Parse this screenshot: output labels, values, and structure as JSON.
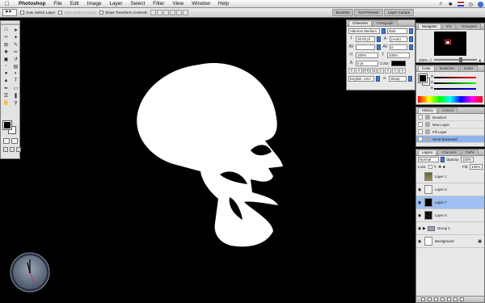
{
  "menubar": {
    "apple": "",
    "items": [
      "Photoshop",
      "File",
      "Edit",
      "Image",
      "Layer",
      "Select",
      "Filter",
      "View",
      "Window",
      "Help"
    ]
  },
  "options_bar": {
    "auto_select_layer": "Auto Select Layer",
    "auto_select_groups": "Auto Select Groups",
    "show_transform_controls": "Show Transform Controls",
    "wells": [
      "Brushes",
      "Tool Presets",
      "Layer Comps"
    ]
  },
  "character_panel": {
    "tabs": [
      "Character",
      "Paragraph"
    ],
    "font_family": "Albertus Medium",
    "font_style": "Italic",
    "font_size": "20.03 pt",
    "leading": "(Auto)",
    "kerning": "",
    "tracking": "0",
    "vertical_scale": "100%",
    "horizontal_scale": "100%",
    "baseline": "0 pt",
    "color_label": "Color:",
    "style_buttons": [
      "T",
      "T",
      "TT",
      "Tt",
      "T",
      "T",
      "T",
      "T"
    ],
    "language": "English: USA",
    "antialias": "Sharp"
  },
  "navigator_panel": {
    "tabs": [
      "Navigator",
      "Info",
      "Histogram"
    ],
    "zoom": "100%"
  },
  "color_panel": {
    "tabs": [
      "Color",
      "Swatches",
      "Styles"
    ],
    "channels": [
      "R",
      "G",
      "B"
    ]
  },
  "history_panel": {
    "tabs": [
      "History",
      "Actions"
    ],
    "items": [
      "Deselect",
      "New Layer",
      "Fill Layer",
      "Send Backward"
    ]
  },
  "layers_panel": {
    "tabs": [
      "Layers",
      "Channels",
      "Paths"
    ],
    "blend_mode": "Normal",
    "opacity_label": "Opacity:",
    "opacity": "100%",
    "lock_label": "Lock:",
    "fill_label": "Fill:",
    "fill": "100%",
    "layers": [
      {
        "name": "Layer 1",
        "active": false
      },
      {
        "name": "Layer 6",
        "active": false
      },
      {
        "name": "Layer 7",
        "active": true
      },
      {
        "name": "Layer 5",
        "active": false
      },
      {
        "name": "Group 1",
        "active": false
      },
      {
        "name": "Background",
        "active": false
      }
    ]
  },
  "colors": {
    "canvas": "#000000",
    "highlight": "#9ec0f2"
  }
}
